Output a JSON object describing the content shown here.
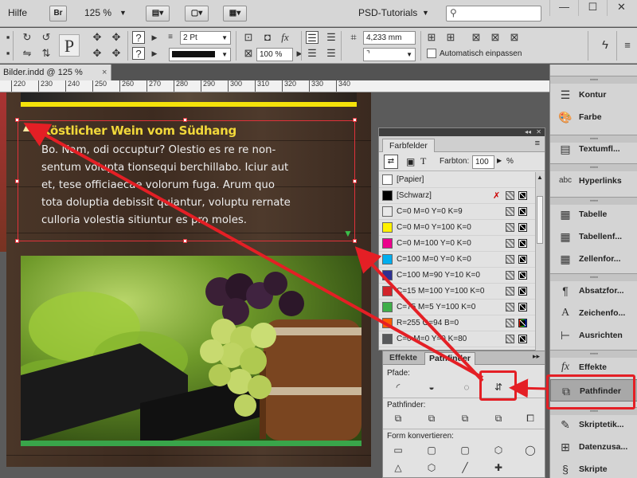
{
  "menubar": {
    "help": "Hilfe",
    "bridge": "Br",
    "zoom": "125 %",
    "workspace": "PSD-Tutorials"
  },
  "control": {
    "stroke_weight": "2 Pt",
    "scale": "100 %",
    "dimension": "4,233 mm",
    "auto_fit": "Automatisch einpassen"
  },
  "document": {
    "tab_title": "Bilder.indd @ 125 %",
    "ruler_ticks": [
      "220",
      "230",
      "240",
      "250",
      "260",
      "270",
      "280",
      "290",
      "300",
      "310",
      "320",
      "330",
      "340"
    ]
  },
  "content": {
    "headline": "Köstlicher Wein vom Südhang",
    "body_lines": [
      "Bo. Nam, odi occuptur? Olestio es re re non-",
      "sentum volupta tionsequi berchillabo. Iciur aut",
      "et, tese officiaecae volorum fuga. Arum quo",
      "tota doluptia debissit quiantur, voluptu rernate",
      "culloria volestia sitiuntur es pro moles."
    ]
  },
  "farbfelder": {
    "tab": "Farbfelder",
    "tint_label": "Farbton:",
    "tint_value": "100",
    "percent": "%",
    "swatches": [
      {
        "name": "[Papier]",
        "color": "#ffffff"
      },
      {
        "name": "[Schwarz]",
        "color": "#000000"
      },
      {
        "name": "C=0 M=0 Y=0 K=9",
        "color": "#e8e8e8"
      },
      {
        "name": "C=0 M=0 Y=100 K=0",
        "color": "#fff200"
      },
      {
        "name": "C=0 M=100 Y=0 K=0",
        "color": "#ec008c"
      },
      {
        "name": "C=100 M=0 Y=0 K=0",
        "color": "#00aeef"
      },
      {
        "name": "C=100 M=90 Y=10 K=0",
        "color": "#2e3192"
      },
      {
        "name": "C=15 M=100 Y=100 K=0",
        "color": "#d2232a"
      },
      {
        "name": "C=75 M=5 Y=100 K=0",
        "color": "#3fae49"
      },
      {
        "name": "R=255 G=94 B=0",
        "color": "#ff5e00"
      },
      {
        "name": "C=0 M=0 Y=0 K=80",
        "color": "#58595b"
      }
    ]
  },
  "pathfinder": {
    "tab_effects": "Effekte",
    "tab_pathfinder": "Pathfinder",
    "section_paths": "Pfade:",
    "section_pathfinder": "Pathfinder:",
    "section_convert": "Form konvertieren:"
  },
  "dock": {
    "items": [
      {
        "label": "Kontur",
        "icon": "stroke-icon"
      },
      {
        "label": "Farbe",
        "icon": "palette-icon"
      },
      {
        "label": "Textumfl...",
        "icon": "text-wrap-icon"
      },
      {
        "label": "Hyperlinks",
        "icon": "hyperlink-icon"
      },
      {
        "label": "Tabelle",
        "icon": "table-icon"
      },
      {
        "label": "Tabellenf...",
        "icon": "table-styles-icon"
      },
      {
        "label": "Zellenfor...",
        "icon": "cell-styles-icon"
      },
      {
        "label": "Absatzfor...",
        "icon": "paragraph-styles-icon"
      },
      {
        "label": "Zeichenfo...",
        "icon": "character-styles-icon"
      },
      {
        "label": "Ausrichten",
        "icon": "align-icon"
      },
      {
        "label": "Effekte",
        "icon": "effects-icon"
      },
      {
        "label": "Pathfinder",
        "icon": "pathfinder-icon"
      },
      {
        "label": "Skriptetik...",
        "icon": "script-label-icon"
      },
      {
        "label": "Datenzusa...",
        "icon": "data-merge-icon"
      },
      {
        "label": "Skripte",
        "icon": "scripts-icon"
      }
    ]
  },
  "colors": {
    "accent_red": "#e41f25",
    "headline_yellow": "#f1d83a"
  }
}
